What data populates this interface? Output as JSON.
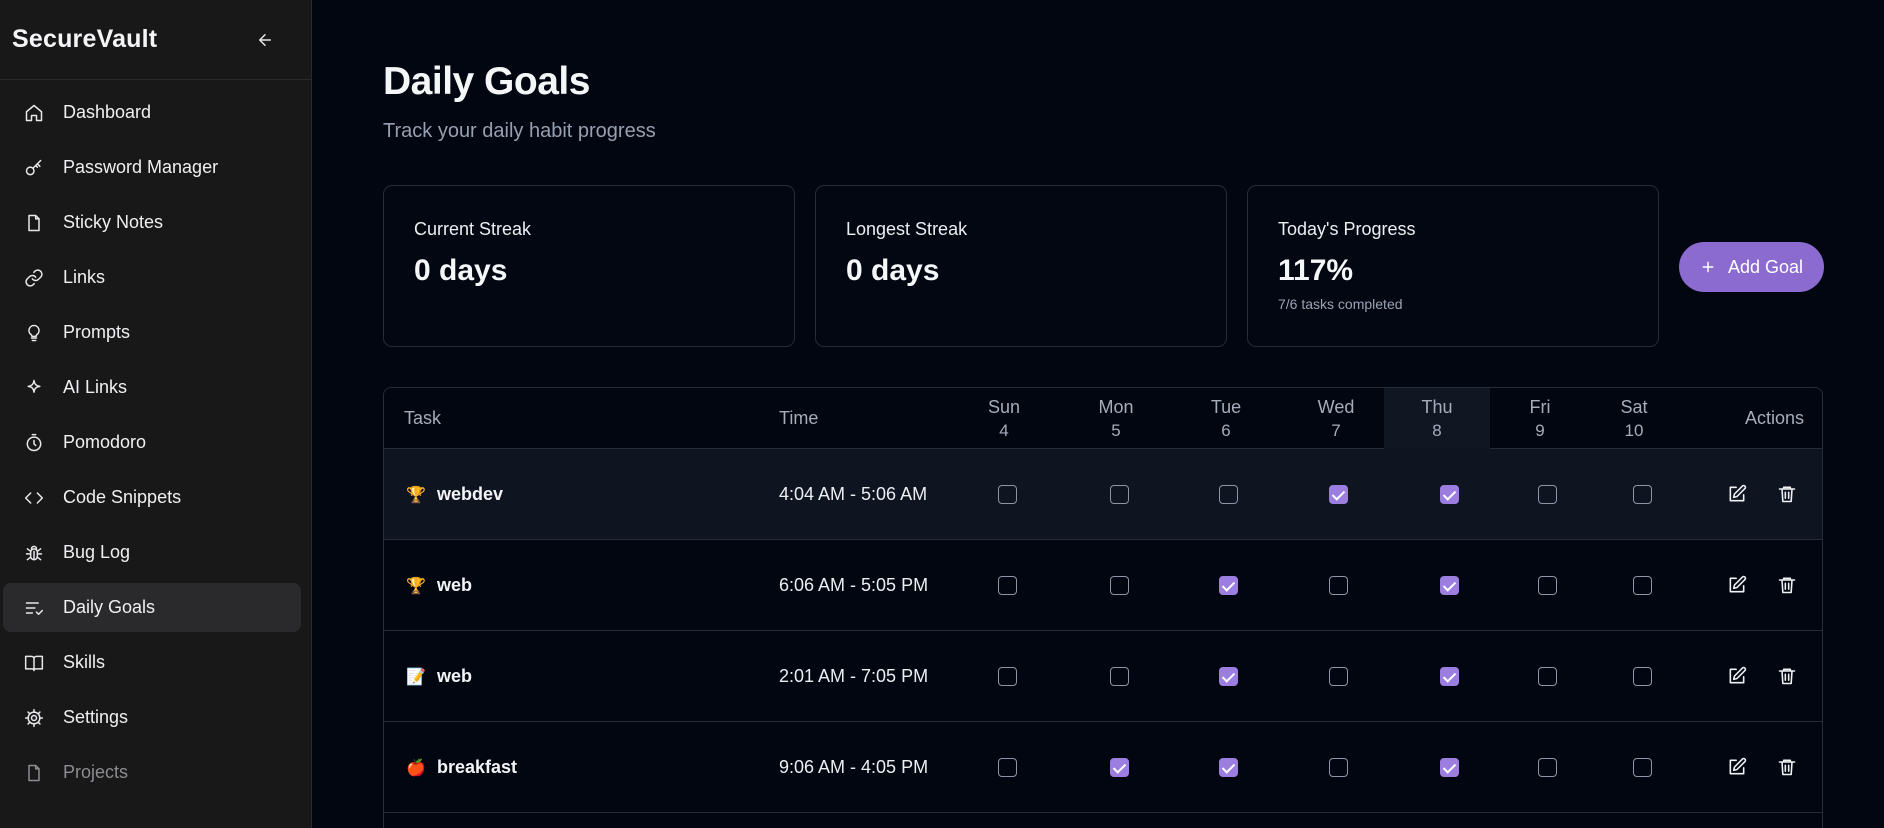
{
  "app": {
    "title": "SecureVault"
  },
  "sidebar": {
    "items": [
      {
        "label": "Dashboard",
        "icon": "home-icon",
        "active": false,
        "dim": false
      },
      {
        "label": "Password Manager",
        "icon": "key-icon",
        "active": false,
        "dim": false
      },
      {
        "label": "Sticky Notes",
        "icon": "file-icon",
        "active": false,
        "dim": false
      },
      {
        "label": "Links",
        "icon": "link-icon",
        "active": false,
        "dim": false
      },
      {
        "label": "Prompts",
        "icon": "lightbulb-icon",
        "active": false,
        "dim": false
      },
      {
        "label": "AI Links",
        "icon": "sparkle-icon",
        "active": false,
        "dim": false
      },
      {
        "label": "Pomodoro",
        "icon": "timer-icon",
        "active": false,
        "dim": false
      },
      {
        "label": "Code Snippets",
        "icon": "code-icon",
        "active": false,
        "dim": false
      },
      {
        "label": "Bug Log",
        "icon": "bug-icon",
        "active": false,
        "dim": false
      },
      {
        "label": "Daily Goals",
        "icon": "list-check-icon",
        "active": true,
        "dim": false
      },
      {
        "label": "Skills",
        "icon": "book-icon",
        "active": false,
        "dim": false
      },
      {
        "label": "Settings",
        "icon": "gear-icon",
        "active": false,
        "dim": false
      },
      {
        "label": "Projects",
        "icon": "file-icon",
        "active": false,
        "dim": true
      }
    ]
  },
  "page": {
    "title": "Daily Goals",
    "subtitle": "Track your daily habit progress"
  },
  "stats": {
    "current_streak": {
      "label": "Current Streak",
      "value": "0 days"
    },
    "longest_streak": {
      "label": "Longest Streak",
      "value": "0 days"
    },
    "today_progress": {
      "label": "Today's Progress",
      "value": "117%",
      "note": "7/6 tasks completed"
    }
  },
  "add_goal_label": "Add Goal",
  "table": {
    "headers": {
      "task": "Task",
      "time": "Time",
      "actions": "Actions"
    },
    "days": [
      {
        "name": "Sun",
        "date": "4",
        "today": false
      },
      {
        "name": "Mon",
        "date": "5",
        "today": false
      },
      {
        "name": "Tue",
        "date": "6",
        "today": false
      },
      {
        "name": "Wed",
        "date": "7",
        "today": false
      },
      {
        "name": "Thu",
        "date": "8",
        "today": true
      },
      {
        "name": "Fri",
        "date": "9",
        "today": false
      },
      {
        "name": "Sat",
        "date": "10",
        "today": false
      }
    ],
    "rows": [
      {
        "emoji": "🏆",
        "task": "webdev",
        "time": "4:04 AM - 5:06 AM",
        "checks": [
          false,
          false,
          false,
          true,
          true,
          false,
          false
        ],
        "highlight": true
      },
      {
        "emoji": "🏆",
        "task": "web",
        "time": "6:06 AM - 5:05 PM",
        "checks": [
          false,
          false,
          true,
          false,
          true,
          false,
          false
        ],
        "highlight": false
      },
      {
        "emoji": "📝",
        "task": "web",
        "time": "2:01 AM - 7:05 PM",
        "checks": [
          false,
          false,
          true,
          false,
          true,
          false,
          false
        ],
        "highlight": false
      },
      {
        "emoji": "🍎",
        "task": "breakfast",
        "time": "9:06 AM - 4:05 PM",
        "checks": [
          false,
          true,
          true,
          false,
          true,
          false,
          false
        ],
        "highlight": false
      }
    ]
  },
  "colors": {
    "accent": "#8b6bd0",
    "checkbox_checked": "#9c7ee0",
    "background": "#020611",
    "sidebar": "#181819"
  }
}
